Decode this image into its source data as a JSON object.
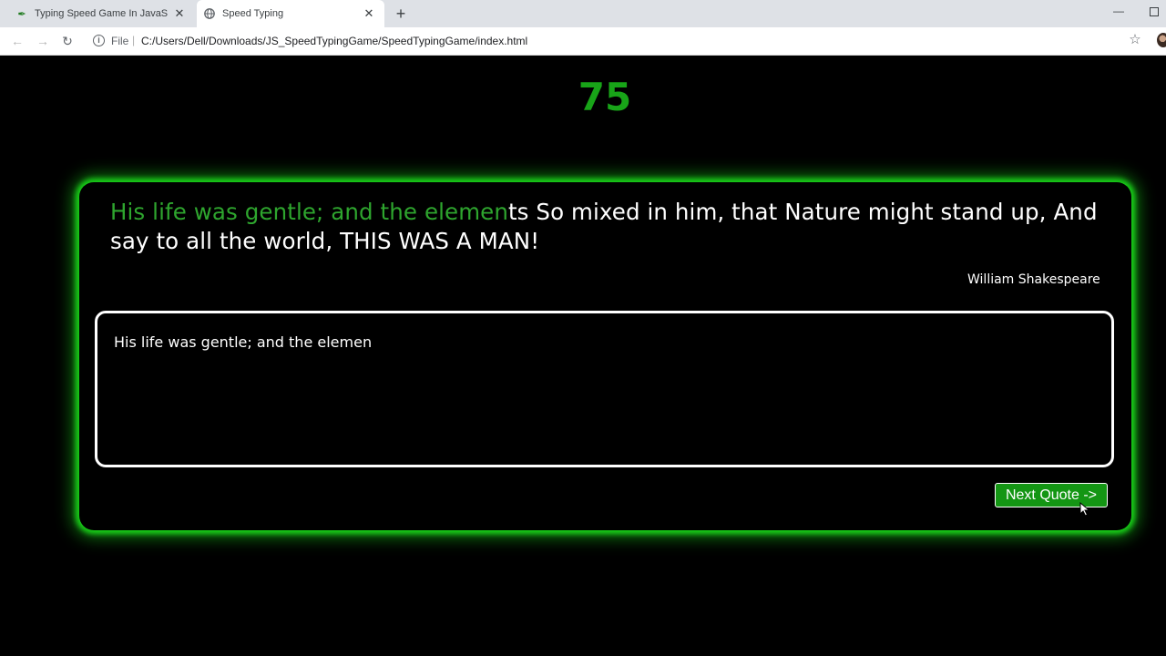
{
  "browser": {
    "tabs": [
      {
        "title": "Typing Speed Game In JavaScript",
        "icon": "feather-icon",
        "active": false
      },
      {
        "title": "Speed Typing",
        "icon": "globe-icon",
        "active": true
      }
    ],
    "address": {
      "scheme": "File",
      "url": "C:/Users/Dell/Downloads/JS_SpeedTypingGame/SpeedTypingGame/index.html"
    }
  },
  "game": {
    "timer": "75",
    "quote": {
      "typed": "His life was gentle; and the elemen",
      "remaining": "ts So mixed in him, that Nature might stand up, And say to all the world, THIS WAS A MAN!"
    },
    "author": "William Shakespeare",
    "input_value": "His life was gentle; and the elemen",
    "next_button": "Next Quote ->"
  },
  "colors": {
    "accent_green": "#18a418",
    "typed_text": "#2ea52e",
    "glow": "#19d019",
    "button_bg": "#149614"
  }
}
